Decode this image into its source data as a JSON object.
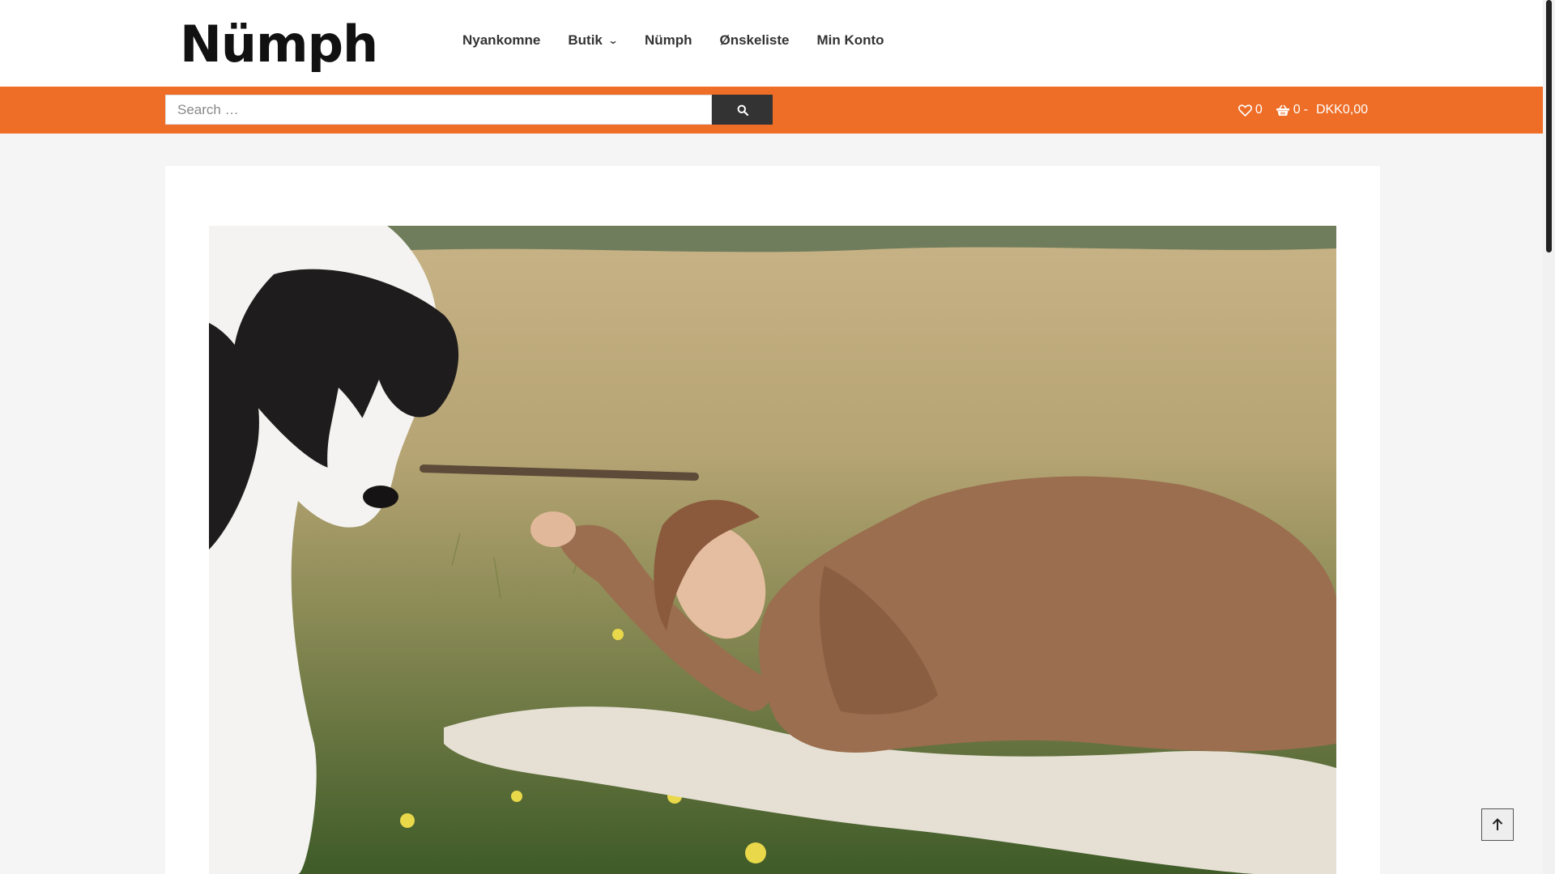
{
  "brand": {
    "logo_text": "Nümph"
  },
  "nav": {
    "items": [
      {
        "label": "Nyankomne",
        "has_dropdown": false
      },
      {
        "label": "Butik",
        "has_dropdown": true
      },
      {
        "label": "Nümph",
        "has_dropdown": false
      },
      {
        "label": "Ønskeliste",
        "has_dropdown": false
      },
      {
        "label": "Min Konto",
        "has_dropdown": false
      }
    ]
  },
  "search": {
    "placeholder": "Search …",
    "button_icon": "search-icon"
  },
  "header_right": {
    "wishlist_count": "0",
    "cart_count": "0",
    "cart_separator": "-",
    "cart_total": "DKK0,00"
  },
  "hero": {
    "alt": "Woman in brown knit lying on a blanket in a flower meadow with a black and white dog"
  },
  "colors": {
    "accent": "#ee6e27",
    "dark": "#333333",
    "white": "#ffffff",
    "page_bg": "#f5f5f5"
  }
}
